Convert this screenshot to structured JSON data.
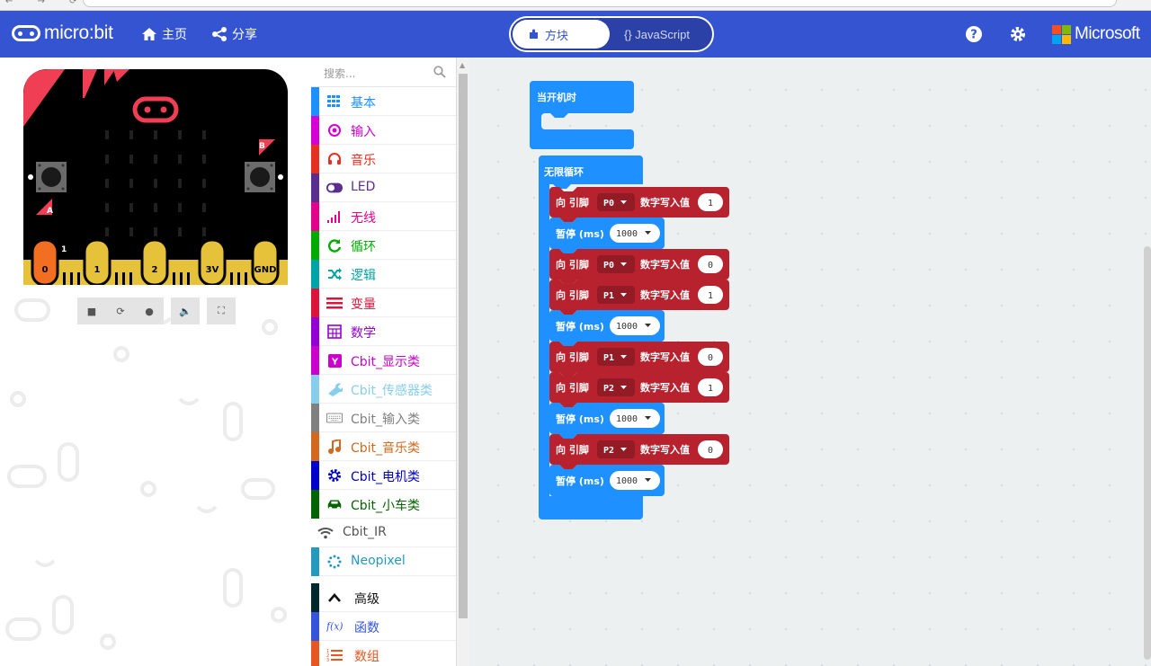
{
  "header": {
    "logo": "micro:bit",
    "home": "主页",
    "share": "分享",
    "mode_blocks": "方块",
    "mode_js": "{} JavaScript",
    "brand": "Microsoft"
  },
  "simulator": {
    "pins": [
      "0",
      "1",
      "2",
      "3V",
      "GND"
    ],
    "pin_mark": "1",
    "btn_a": "A",
    "btn_b": "B"
  },
  "toolbox": {
    "search_placeholder": "搜索...",
    "categories": [
      {
        "label": "基本",
        "color": "#1e90ff",
        "icon": "grid-icon"
      },
      {
        "label": "输入",
        "color": "#d400d4",
        "icon": "target-icon"
      },
      {
        "label": "音乐",
        "color": "#e63022",
        "icon": "headphones-icon"
      },
      {
        "label": "LED",
        "color": "#5c2d91",
        "icon": "toggle-icon"
      },
      {
        "label": "无线",
        "color": "#e3008c",
        "icon": "signal-icon"
      },
      {
        "label": "循环",
        "color": "#00aa00",
        "icon": "loop-icon"
      },
      {
        "label": "逻辑",
        "color": "#00a4a6",
        "icon": "shuffle-icon"
      },
      {
        "label": "变量",
        "color": "#dc143c",
        "icon": "list-icon"
      },
      {
        "label": "数学",
        "color": "#9400d3",
        "icon": "calculator-icon"
      },
      {
        "label": "Cbit_显示类",
        "color": "#cc00cc",
        "icon": "y-icon"
      },
      {
        "label": "Cbit_传感器类",
        "color": "#87ceeb",
        "icon": "wrench-icon"
      },
      {
        "label": "Cbit_输入类",
        "color": "#808080",
        "icon": "keyboard-icon"
      },
      {
        "label": "Cbit_音乐类",
        "color": "#d2691e",
        "icon": "note-icon"
      },
      {
        "label": "Cbit_电机类",
        "color": "#0000cd",
        "icon": "gear-outline-icon"
      },
      {
        "label": "Cbit_小车类",
        "color": "#006400",
        "icon": "car-icon"
      },
      {
        "label": "Cbit_IR",
        "color": "#ffffff",
        "icon": "wifi-icon"
      },
      {
        "label": "Neopixel",
        "color": "#2699bf",
        "icon": "dots-circle-icon"
      }
    ],
    "advanced": [
      {
        "label": "高级",
        "color": "#00272b",
        "icon": "chevron-up-icon"
      },
      {
        "label": "函数",
        "color": "#3455db",
        "icon": "function-icon"
      },
      {
        "label": "数组",
        "color": "#e65722",
        "icon": "array-icon"
      }
    ]
  },
  "blocks": {
    "on_start": "当开机时",
    "forever": "无限循环",
    "pause_label": "暂停 (ms)",
    "write_prefix": "向 引脚",
    "write_suffix": "数字写入值",
    "rows": [
      {
        "type": "write",
        "pin": "P0",
        "value": "1"
      },
      {
        "type": "pause",
        "value": "1000"
      },
      {
        "type": "write",
        "pin": "P0",
        "value": "0"
      },
      {
        "type": "write",
        "pin": "P1",
        "value": "1"
      },
      {
        "type": "pause",
        "value": "1000"
      },
      {
        "type": "write",
        "pin": "P1",
        "value": "0"
      },
      {
        "type": "write",
        "pin": "P2",
        "value": "1"
      },
      {
        "type": "pause",
        "value": "1000"
      },
      {
        "type": "write",
        "pin": "P2",
        "value": "0"
      },
      {
        "type": "pause",
        "value": "1000"
      }
    ]
  },
  "colors": {
    "header": "#3454d1",
    "pins_block": "#b8222e",
    "pins_block_dark": "#931b25",
    "basic_block": "#1e90ff",
    "board": "#000000",
    "gold": "#e6c23a"
  }
}
